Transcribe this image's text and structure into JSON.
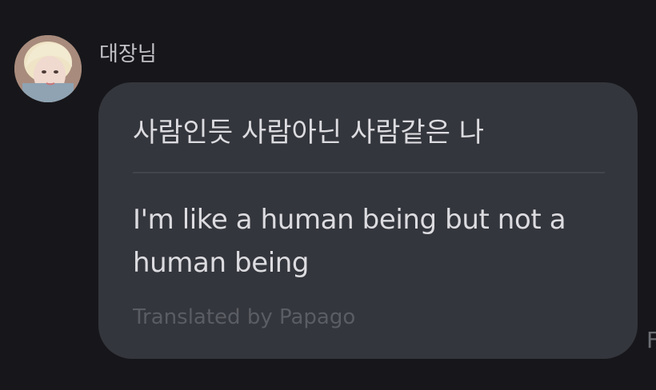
{
  "message": {
    "sender_name": "대장님",
    "avatar_icon": "profile-photo",
    "original_text": "사람인듯 사람아닌 사람같은 나",
    "translated_text": "I'm like a human being but not a human being",
    "translator_credit": "Translated by Papago"
  },
  "edge_text": "F",
  "colors": {
    "background": "#17171b",
    "bubble": "#34363d",
    "text": "#dcdce0",
    "muted_text": "#5b5d64",
    "divider": "#43454c"
  }
}
